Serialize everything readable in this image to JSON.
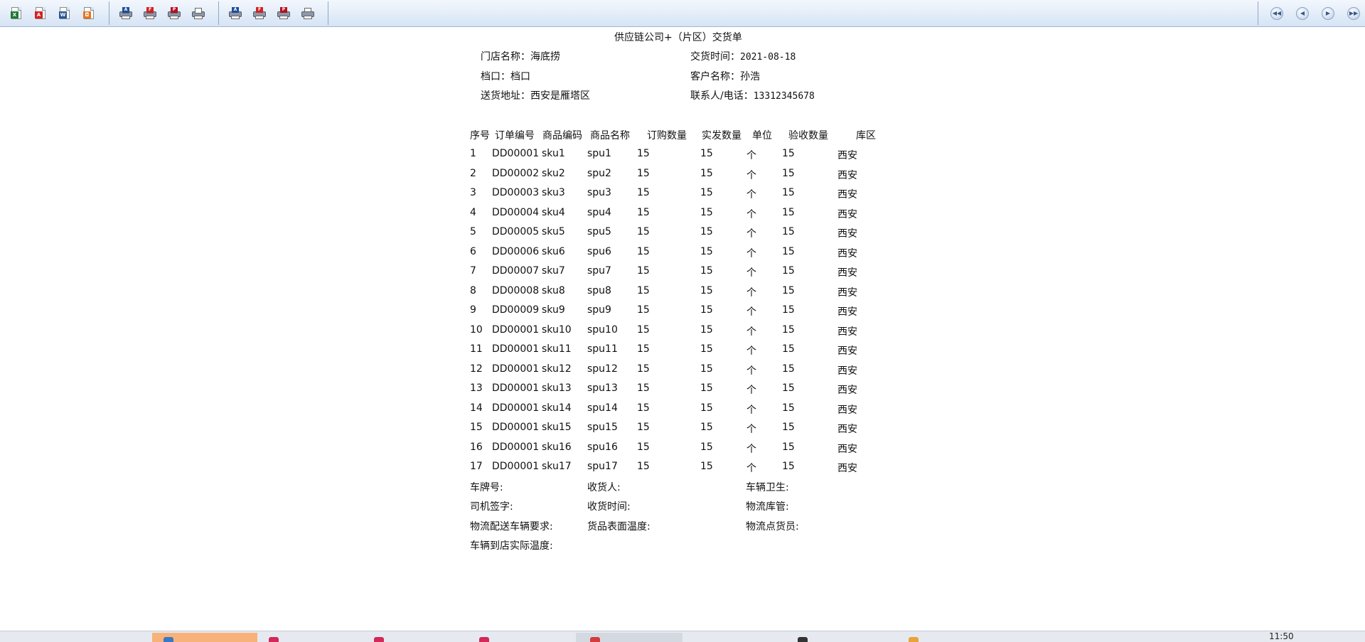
{
  "toolbar": {
    "export_buttons": [
      {
        "name": "export-excel-icon",
        "label": "X",
        "color": "#1e7b34"
      },
      {
        "name": "export-pdf-icon",
        "label": "A",
        "color": "#d32222"
      },
      {
        "name": "export-word-icon",
        "label": "W",
        "color": "#2b5797"
      },
      {
        "name": "export-image-icon",
        "label": "◘",
        "color": "#e8741e"
      }
    ],
    "print_preview_buttons": [
      {
        "name": "print-preview-a-icon",
        "label": "A",
        "color": "#1f4e9c"
      },
      {
        "name": "print-preview-f-icon",
        "label": "F",
        "color": "#d32222"
      },
      {
        "name": "print-preview-p-icon",
        "label": "P",
        "color": "#b3121e"
      },
      {
        "name": "print-preview-icon",
        "label": "",
        "color": "#6e7a8a"
      }
    ],
    "print_buttons": [
      {
        "name": "print-a-icon",
        "label": "A",
        "color": "#1f4e9c"
      },
      {
        "name": "print-f-icon",
        "label": "F",
        "color": "#d32222"
      },
      {
        "name": "print-p-icon",
        "label": "P",
        "color": "#b3121e"
      },
      {
        "name": "print-icon",
        "label": "",
        "color": "#6e7a8a"
      }
    ],
    "nav_buttons": [
      {
        "name": "first-page-icon",
        "label": "◀◀"
      },
      {
        "name": "prev-page-icon",
        "label": "◀"
      },
      {
        "name": "next-page-icon",
        "label": "▶"
      },
      {
        "name": "last-page-icon",
        "label": "▶▶"
      }
    ]
  },
  "report": {
    "title": "供应链公司+（片区）交货单",
    "store_name_label": "门店名称：",
    "store_name": "海底捞",
    "delivery_time_label": "交货时间：",
    "delivery_time": "2021-08-18",
    "stall_label": "档口：",
    "stall": "档口",
    "customer_label": "客户名称：",
    "customer": "孙浩",
    "address_label": "送货地址：",
    "address": "西安是雁塔区",
    "contact_label": "联系人/电话：",
    "contact": "13312345678",
    "columns": [
      "序号",
      "订单编号",
      "商品编码",
      "商品名称",
      "订购数量",
      "实发数量",
      "单位",
      "验收数量",
      "库区"
    ],
    "rows": [
      [
        "1",
        "DD00001",
        "sku1",
        "spu1",
        "15",
        "15",
        "个",
        "15",
        "西安"
      ],
      [
        "2",
        "DD00002",
        "sku2",
        "spu2",
        "15",
        "15",
        "个",
        "15",
        "西安"
      ],
      [
        "3",
        "DD00003",
        "sku3",
        "spu3",
        "15",
        "15",
        "个",
        "15",
        "西安"
      ],
      [
        "4",
        "DD00004",
        "sku4",
        "spu4",
        "15",
        "15",
        "个",
        "15",
        "西安"
      ],
      [
        "5",
        "DD00005",
        "sku5",
        "spu5",
        "15",
        "15",
        "个",
        "15",
        "西安"
      ],
      [
        "6",
        "DD00006",
        "sku6",
        "spu6",
        "15",
        "15",
        "个",
        "15",
        "西安"
      ],
      [
        "7",
        "DD00007",
        "sku7",
        "spu7",
        "15",
        "15",
        "个",
        "15",
        "西安"
      ],
      [
        "8",
        "DD00008",
        "sku8",
        "spu8",
        "15",
        "15",
        "个",
        "15",
        "西安"
      ],
      [
        "9",
        "DD00009",
        "sku9",
        "spu9",
        "15",
        "15",
        "个",
        "15",
        "西安"
      ],
      [
        "10",
        "DD00001",
        "sku10",
        "spu10",
        "15",
        "15",
        "个",
        "15",
        "西安"
      ],
      [
        "11",
        "DD00001",
        "sku11",
        "spu11",
        "15",
        "15",
        "个",
        "15",
        "西安"
      ],
      [
        "12",
        "DD00001",
        "sku12",
        "spu12",
        "15",
        "15",
        "个",
        "15",
        "西安"
      ],
      [
        "13",
        "DD00001",
        "sku13",
        "spu13",
        "15",
        "15",
        "个",
        "15",
        "西安"
      ],
      [
        "14",
        "DD00001",
        "sku14",
        "spu14",
        "15",
        "15",
        "个",
        "15",
        "西安"
      ],
      [
        "15",
        "DD00001",
        "sku15",
        "spu15",
        "15",
        "15",
        "个",
        "15",
        "西安"
      ],
      [
        "16",
        "DD00001",
        "sku16",
        "spu16",
        "15",
        "15",
        "个",
        "15",
        "西安"
      ],
      [
        "17",
        "DD00001",
        "sku17",
        "spu17",
        "15",
        "15",
        "个",
        "15",
        "西安"
      ]
    ],
    "footer": {
      "plate_label": "车牌号:",
      "receiver_label": "收货人:",
      "hygiene_label": "车辆卫生:",
      "driver_sign_label": "司机签字:",
      "receive_time_label": "收货时间:",
      "warehouse_mgr_label": "物流库管:",
      "vehicle_req_label": "物流配送车辆要求:",
      "surface_temp_label": "货品表面温度:",
      "checker_label": "物流点货员:",
      "arrival_temp_label": "车辆到店实际温度:"
    }
  },
  "taskbar": {
    "clock": "11:50"
  }
}
